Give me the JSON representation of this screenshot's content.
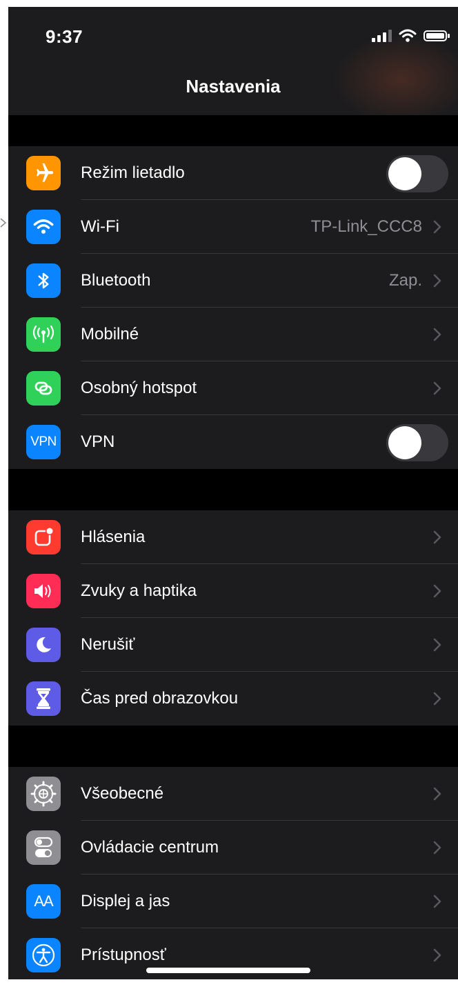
{
  "status_bar": {
    "time": "9:37"
  },
  "nav": {
    "title": "Nastavenia"
  },
  "sections": [
    {
      "rows": [
        {
          "label": "Režim lietadlo",
          "icon": "airplane-icon",
          "color": "#ff9500",
          "control": "toggle",
          "on": false
        },
        {
          "label": "Wi-Fi",
          "value": "TP-Link_CCC8",
          "icon": "wifi-icon",
          "color": "#0a84ff",
          "control": "chevron"
        },
        {
          "label": "Bluetooth",
          "value": "Zap.",
          "icon": "bluetooth-icon",
          "color": "#0a84ff",
          "control": "chevron"
        },
        {
          "label": "Mobilné",
          "icon": "cellular-antenna-icon",
          "color": "#30d158",
          "control": "chevron"
        },
        {
          "label": "Osobný hotspot",
          "icon": "hotspot-link-icon",
          "color": "#30d158",
          "control": "chevron"
        },
        {
          "label": "VPN",
          "icon": "vpn-icon",
          "icon_text": "VPN",
          "color": "#0a84ff",
          "control": "toggle",
          "on": false
        }
      ]
    },
    {
      "rows": [
        {
          "label": "Hlásenia",
          "icon": "notifications-icon",
          "color": "#ff3b30",
          "control": "chevron"
        },
        {
          "label": "Zvuky a haptika",
          "icon": "speaker-icon",
          "color": "#ff2d55",
          "control": "chevron"
        },
        {
          "label": "Nerušiť",
          "icon": "moon-icon",
          "color": "#5e5ce6",
          "control": "chevron"
        },
        {
          "label": "Čas pred obrazovkou",
          "icon": "hourglass-icon",
          "color": "#5e5ce6",
          "control": "chevron"
        }
      ]
    },
    {
      "rows": [
        {
          "label": "Všeobecné",
          "icon": "gear-icon",
          "color": "#8e8e93",
          "control": "chevron"
        },
        {
          "label": "Ovládacie centrum",
          "icon": "switches-icon",
          "color": "#8e8e93",
          "control": "chevron"
        },
        {
          "label": "Displej a jas",
          "icon": "text-size-icon",
          "icon_text": "AA",
          "color": "#0a84ff",
          "control": "chevron"
        },
        {
          "label": "Prístupnosť",
          "icon": "accessibility-icon",
          "color": "#0a84ff",
          "control": "chevron"
        }
      ]
    }
  ]
}
